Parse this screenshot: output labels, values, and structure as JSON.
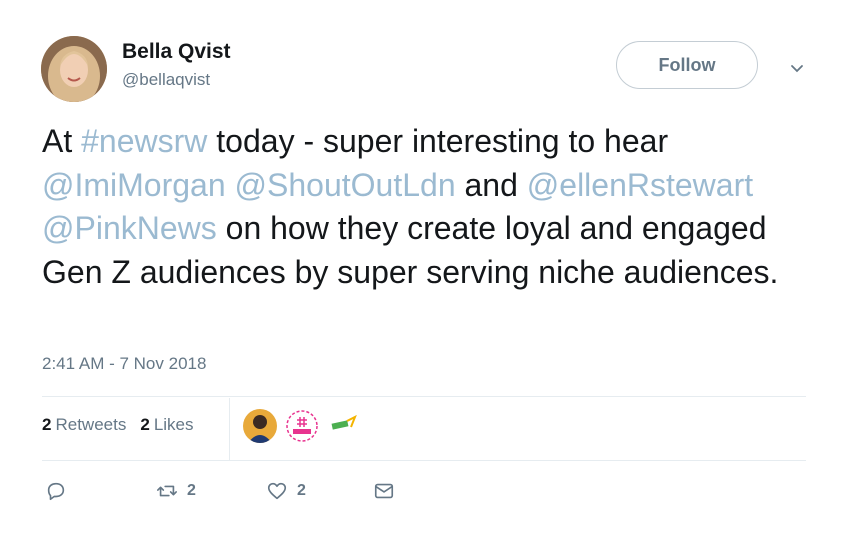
{
  "author": {
    "name": "Bella Qvist",
    "handle": "@bellaqvist"
  },
  "follow_label": "Follow",
  "tweet": {
    "segments": [
      {
        "text": "At ",
        "type": "text"
      },
      {
        "text": "#newsrw",
        "type": "hashtag"
      },
      {
        "text": " today - super interesting to hear ",
        "type": "text"
      },
      {
        "text": "@ImiMorgan",
        "type": "mention"
      },
      {
        "text": " ",
        "type": "text"
      },
      {
        "text": "@ShoutOutLdn",
        "type": "mention"
      },
      {
        "text": " and ",
        "type": "text"
      },
      {
        "text": "@ellenRstewart",
        "type": "mention"
      },
      {
        "text": " ",
        "type": "text"
      },
      {
        "text": "@PinkNews",
        "type": "mention"
      },
      {
        "text": " on how they create loyal and engaged Gen Z audiences by super serving niche audiences.",
        "type": "text"
      }
    ],
    "link_color": "#9bbad1"
  },
  "timestamp": "2:41 AM - 7 Nov 2018",
  "stats": {
    "retweets_count": "2",
    "retweets_label": "Retweets",
    "likes_count": "2",
    "likes_label": "Likes"
  },
  "likers": [
    {
      "icon": "user-avatar"
    },
    {
      "icon": "newsrw-logo"
    },
    {
      "icon": "shoutout-logo"
    }
  ],
  "actions": {
    "reply_count": "",
    "retweet_count": "2",
    "like_count": "2"
  }
}
